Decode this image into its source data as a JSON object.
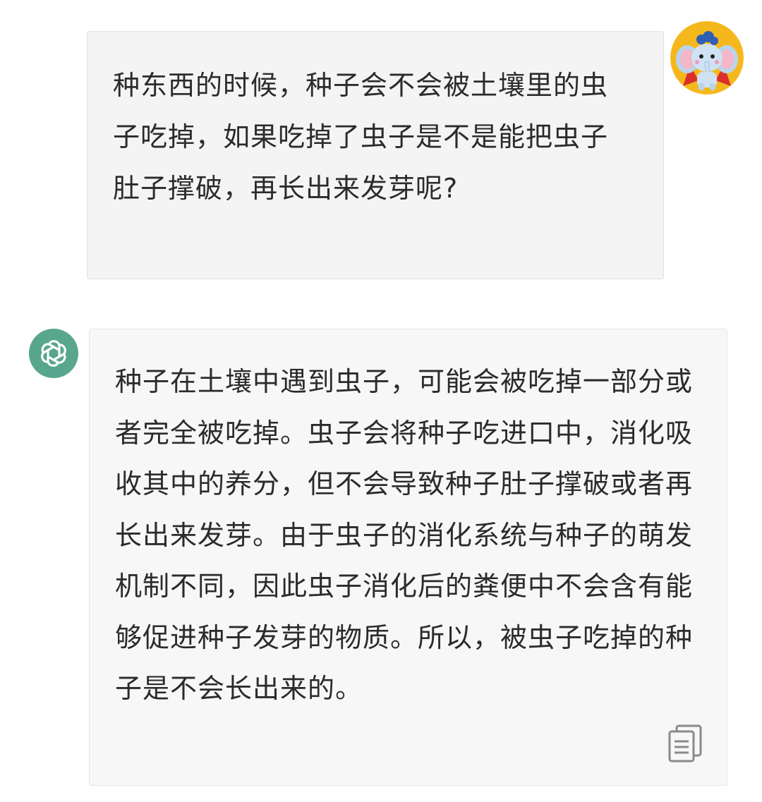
{
  "conversation": {
    "user_message": {
      "text": "种东西的时候，种子会不会被土壤里的虫子吃掉，如果吃掉了虫子是不是能把虫子肚子撑破，再长出来发芽呢?",
      "avatar_icon": "elephant-avatar-icon"
    },
    "assistant_message": {
      "text": "种子在土壤中遇到虫子，可能会被吃掉一部分或者完全被吃掉。虫子会将种子吃进口中，消化吸收其中的养分，但不会导致种子肚子撑破或者再长出来发芽。由于虫子的消化系统与种子的萌发机制不同，因此虫子消化后的粪便中不会含有能够促进种子发芽的物质。所以，被虫子吃掉的种子是不会长出来的。",
      "avatar_icon": "openai-logo-icon",
      "avatar_color": "#58a68d",
      "copy_icon": "copy-icon"
    }
  },
  "colors": {
    "user_bubble_bg": "#f4f4f4",
    "assistant_bubble_bg": "#f7f7f7",
    "text": "#2b2b2b"
  }
}
